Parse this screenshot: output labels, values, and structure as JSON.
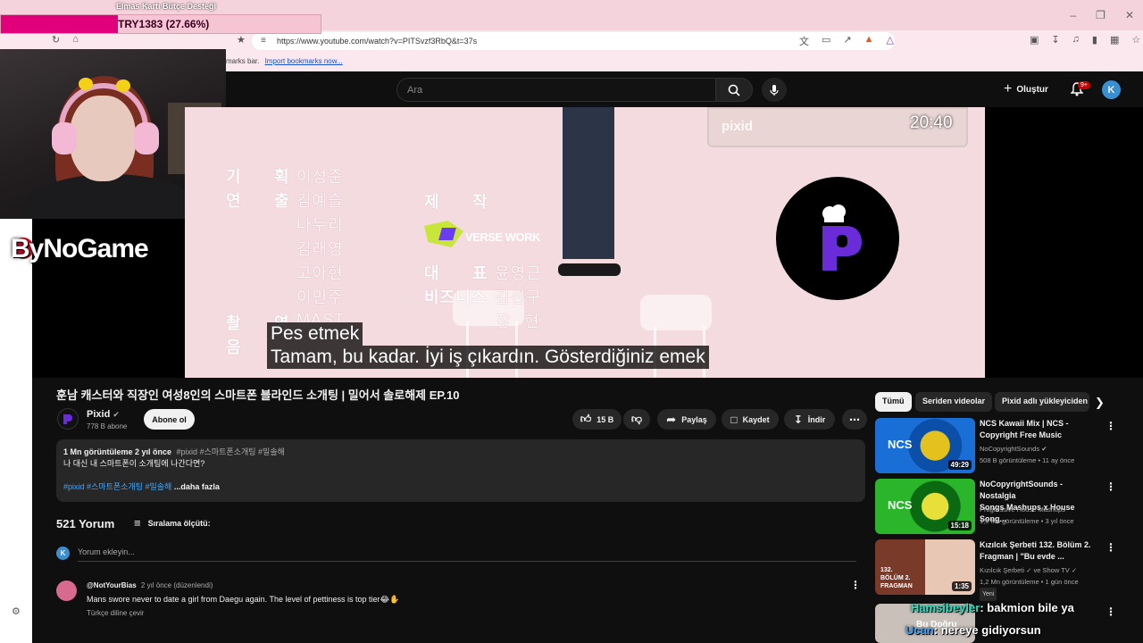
{
  "browser": {
    "url": "https://www.youtube.com/watch?v=PITSvzf3RbQ&t=37s",
    "bookmarks_hint": "marks bar.",
    "import_bookmarks": "Import bookmarks now..."
  },
  "overlay": {
    "donation_title": "Elmas Kartı Bütçe Desteği",
    "donation_progress": "TRY1383 (27.66%)",
    "donation_fraction": 0.3661,
    "sponsor": "ByNoGame",
    "chat": [
      {
        "user": "Hamsibeyler",
        "message": ": bakmion bile ya"
      },
      {
        "user": "Ucan",
        "message": ": nereye gidiyorsun"
      }
    ]
  },
  "header": {
    "search_placeholder": "Ara",
    "create_label": "Oluştur",
    "notification_count": "9+",
    "avatar_letter": "K"
  },
  "player": {
    "credits_left": [
      "기",
      "연"
    ],
    "credits_left2": [
      "획",
      "출"
    ],
    "credits_names": [
      "이성준",
      "김예슬",
      "나누리",
      "김래영",
      "고아현",
      "이민주"
    ],
    "credits_bottom_left": [
      "촬",
      "영"
    ],
    "credits_bottom_left2": [
      "음"
    ],
    "credits_mid_top": [
      "제",
      "작"
    ],
    "credits_mid": [
      "대",
      "표"
    ],
    "credits_rep": "윤영근",
    "credits_business": "비즈니스",
    "credits_business_name": "김선구",
    "credits_misc": [
      "장",
      "현"
    ],
    "credits_mast": "MAST",
    "verse_work": "VERSE WORK",
    "thumb_overlay_label": "pixid",
    "thumb_overlay_time": "20:40",
    "subtitle_line1": "Pes etmek",
    "subtitle_line2": "Tamam, bu kadar. İyi iş çıkardın. Gösterdiğiniz emek"
  },
  "video": {
    "title": "훈남 캐스터와 직장인 여성8인의 스마트폰 블라인드 소개팅 | 밀어서 솔로해제 EP.10",
    "channel_name": "Pixid",
    "channel_subs": "778 B abone",
    "subscribe_label": "Abone ol",
    "like_count": "15 B",
    "share_label": "Paylaş",
    "save_label": "Kaydet",
    "download_label": "İndir",
    "views_date": "1 Mn görüntüleme  2 yıl önce",
    "meta_tags": "#pixid #스마트폰소개팅 #밀솔해",
    "description_line": "나 대신 내 스마트폰이 소개팅에 나간다면?",
    "tags_line": "#pixid #스마트폰소개팅 #밀솔해",
    "more_label": "...daha fazla"
  },
  "comments": {
    "count_label": "521 Yorum",
    "sort_label": "Sıralama ölçütü:",
    "add_placeholder": "Yorum ekleyin...",
    "items": [
      {
        "author": "@NotYourBias",
        "time": "2 yıl önce (düzenlendi)",
        "text": "Mans swore never to date a girl from Daegu again. The level of pettiness is top tier😂✋",
        "translate": "Türkçe diline çevir"
      }
    ]
  },
  "chips": [
    "Tümü",
    "Seriden videolar",
    "Pixid adlı yükleyiciden"
  ],
  "recommendations": [
    {
      "title_line1": "NCS Kawaii Mix | NCS -",
      "title_line2": "Copyright Free Music",
      "channel": "NoCopyrightSounds",
      "meta": "508 B görüntüleme • 11 ay önce",
      "duration": "49:29",
      "thumb_color": "#1a6fd6",
      "accent": "#e3c21d"
    },
    {
      "title_line1": "NoCopyrightSounds - Nostalgia",
      "title_line2": "Songs Mashups x House Song...",
      "channel": "Progressive House Mashups",
      "meta": "1,6 Mn görüntüleme • 3 yıl önce",
      "duration": "15:18",
      "thumb_color": "#2bb52b",
      "accent": "#e8e03a"
    },
    {
      "title_line1": "Kızılcık Şerbeti 132. Bölüm 2.",
      "title_line2": "Fragman | \"Bu evde ...",
      "channel": "Kızılcık Şerbeti ✓ ve Show TV ✓",
      "meta": "1,2 Mn görüntüleme • 1 gün önce",
      "duration": "1:35",
      "badge": "Yeni",
      "thumb_label": "132. BÖLÜM 2. FRAGMAN",
      "thumb_color": "#7a3a2a",
      "accent": "#e9c7b5"
    },
    {
      "thumb_label": "Bu Doğru",
      "thumb_color": "#c9c0ba",
      "accent": "#ffffff"
    }
  ]
}
